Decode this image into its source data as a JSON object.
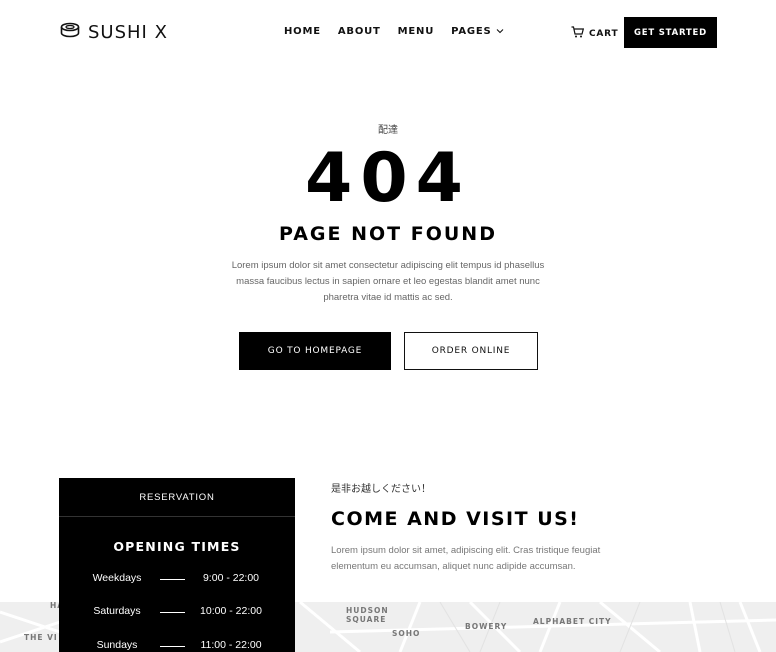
{
  "header": {
    "logo_text": "SUSHI X",
    "nav": [
      {
        "label": "HOME"
      },
      {
        "label": "ABOUT"
      },
      {
        "label": "MENU"
      },
      {
        "label": "PAGES",
        "has_dropdown": true
      }
    ],
    "cart_label": "CART",
    "cta_label": "GET STARTED"
  },
  "hero": {
    "kanji": "配達",
    "code": "404",
    "title": "PAGE NOT FOUND",
    "description": "Lorem ipsum dolor sit amet consectetur adipiscing elit tempus id phasellus massa faucibus lectus in sapien ornare et leo egestas blandit amet nunc pharetra vitae id mattis ac sed.",
    "primary_button": "GO TO HOMEPAGE",
    "secondary_button": "ORDER ONLINE"
  },
  "reservation": {
    "header": "RESERVATION",
    "title": "OPENING TIMES",
    "hours": [
      {
        "day": "Weekdays",
        "time": "9:00 - 22:00"
      },
      {
        "day": "Saturdays",
        "time": "10:00 - 22:00"
      },
      {
        "day": "Sundays",
        "time": "11:00 - 22:00"
      }
    ]
  },
  "visit": {
    "kanji": "是非お越しください！",
    "title": "COME AND VISIT US!",
    "text": "Lorem ipsum dolor sit amet, adipiscing elit. Cras tristique feugiat elementum eu accumsan, aliquet nunc adipide accumsan."
  },
  "map": {
    "labels": [
      "HUDSON SQUARE",
      "SOHO",
      "BOWERY",
      "ALPHABET CITY",
      "THE VI",
      "HA"
    ]
  },
  "colors": {
    "primary": "#000000",
    "background": "#ffffff",
    "muted_text": "#666666",
    "map_bg": "#efefef"
  },
  "icons": {
    "logo": "sushi-roll-icon",
    "cart": "cart-icon",
    "dropdown": "chevron-down-icon"
  }
}
